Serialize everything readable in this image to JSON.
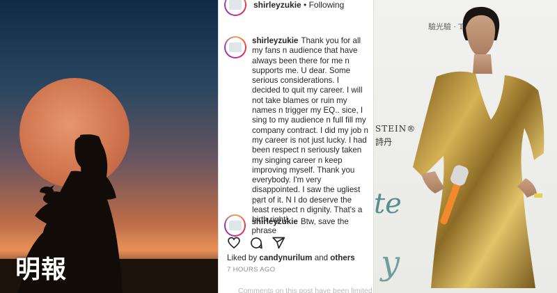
{
  "left_photo": {
    "watermark": "明報"
  },
  "instagram": {
    "header": {
      "username": "shirleyzukie",
      "separator": "•",
      "follow_status": "Following"
    },
    "caption": {
      "username": "shirleyzukie",
      "text": "Thank you for all my fans n audience that have always been there for me n supports me. U dear. Some serious considerations. I decided to quit my career. I will not take blames or ruin my names n trigger my EQ.. sice, I sing to my audience n full fill my company contract. I did my job n my career is not just lucky. I had been respect n seriously taken my singing career n keep improving myself. Thank you everybody. I'm very disappointed. I saw the ugliest part of it. N I do deserve the least respect n dignity. That's a birth right!",
      "time": "7h"
    },
    "comment": {
      "username": "shirleyzukie",
      "text": "Btw, save the phrase"
    },
    "actions": {
      "like_icon": "heart-icon",
      "comment_icon": "comment-icon",
      "share_icon": "share-icon"
    },
    "likes": {
      "prefix": "Liked by",
      "user": "candynurilum",
      "and": "and",
      "others": "others"
    },
    "post_time": "7 HOURS AGO",
    "comments_notice": "Comments on this post have been limited"
  },
  "right_photo": {
    "backdrop_top": "驗光驗 · The",
    "backdrop_brand": "STEIN®",
    "backdrop_chinese": "詩丹",
    "deco_1": "te",
    "deco_2": "y"
  }
}
